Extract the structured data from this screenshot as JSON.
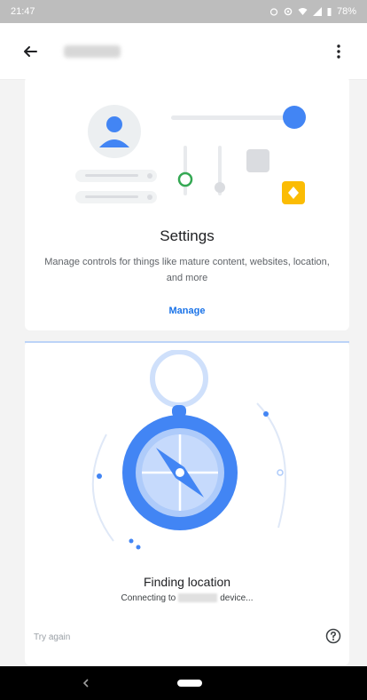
{
  "status_bar": {
    "time": "21:47",
    "battery": "78%"
  },
  "settings_card": {
    "title": "Settings",
    "description": "Manage controls for things like mature content, websites, location, and more",
    "action_label": "Manage"
  },
  "location_card": {
    "title": "Finding location",
    "connecting_prefix": "Connecting to",
    "connecting_suffix": "device...",
    "retry_label": "Try again"
  },
  "icons": {
    "back": "arrow-back-icon",
    "menu": "more-vert-icon",
    "help": "help-icon",
    "nav_back": "nav-back-icon",
    "nav_home": "nav-home-pill"
  },
  "colors": {
    "accent": "#1a73e8",
    "illustration_blue": "#4285f4",
    "light_blue": "#aecbfa",
    "yellow": "#fbbc04",
    "green": "#34a853"
  }
}
